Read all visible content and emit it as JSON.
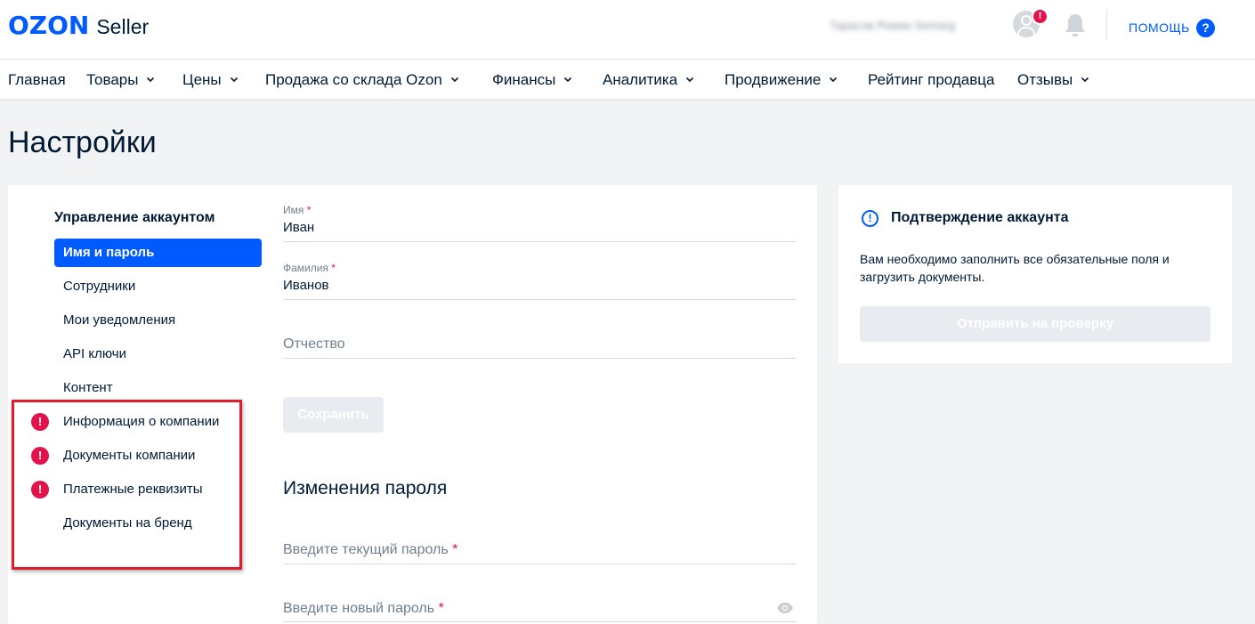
{
  "header": {
    "logo_brand": "OZON",
    "logo_product": "Seller",
    "user_name": "Тарасов Роман Semarg",
    "notification_badge": "!",
    "help_label": "ПОМОЩЬ",
    "help_icon_glyph": "?"
  },
  "nav": {
    "items": [
      {
        "label": "Главная",
        "has_dropdown": false
      },
      {
        "label": "Товары",
        "has_dropdown": true
      },
      {
        "label": "Цены",
        "has_dropdown": true
      },
      {
        "label": "Продажа со склада Ozon",
        "has_dropdown": true
      },
      {
        "label": "Финансы",
        "has_dropdown": true
      },
      {
        "label": "Аналитика",
        "has_dropdown": true
      },
      {
        "label": "Продвижение",
        "has_dropdown": true
      },
      {
        "label": "Рейтинг продавца",
        "has_dropdown": false
      },
      {
        "label": "Отзывы",
        "has_dropdown": true
      }
    ]
  },
  "page": {
    "title": "Настройки"
  },
  "sidebar": {
    "heading": "Управление аккаунтом",
    "items": [
      {
        "label": "Имя и пароль",
        "active": true,
        "alert": false
      },
      {
        "label": "Сотрудники",
        "active": false,
        "alert": false
      },
      {
        "label": "Мои уведомления",
        "active": false,
        "alert": false
      },
      {
        "label": "API ключи",
        "active": false,
        "alert": false
      },
      {
        "label": "Контент",
        "active": false,
        "alert": false
      },
      {
        "label": "Информация о компании",
        "active": false,
        "alert": true
      },
      {
        "label": "Документы компании",
        "active": false,
        "alert": true
      },
      {
        "label": "Платежные реквизиты",
        "active": false,
        "alert": true
      },
      {
        "label": "Документы на бренд",
        "active": false,
        "alert": false
      }
    ],
    "alert_glyph": "!"
  },
  "form": {
    "first_name": {
      "label": "Имя",
      "required_mark": "*",
      "value": "Иван"
    },
    "last_name": {
      "label": "Фамилия",
      "required_mark": "*",
      "value": "Иванов"
    },
    "patronymic": {
      "placeholder": "Отчество",
      "value": ""
    },
    "save_label": "Сохранить",
    "password_section_title": "Изменения пароля",
    "current_password": {
      "placeholder": "Введите текущий пароль",
      "required_mark": "*"
    },
    "new_password": {
      "placeholder": "Введите новый пароль",
      "required_mark": "*"
    }
  },
  "verification": {
    "info_glyph": "!",
    "title": "Подтверждение аккаунта",
    "text": "Вам необходимо заполнить все обязательные поля и загрузить документы.",
    "button_label": "Отправить на проверку"
  },
  "colors": {
    "brand_blue": "#005bff",
    "alert_red": "#e0144b",
    "highlight_red": "#e01e2b",
    "disabled_button": "#e8ebef"
  }
}
